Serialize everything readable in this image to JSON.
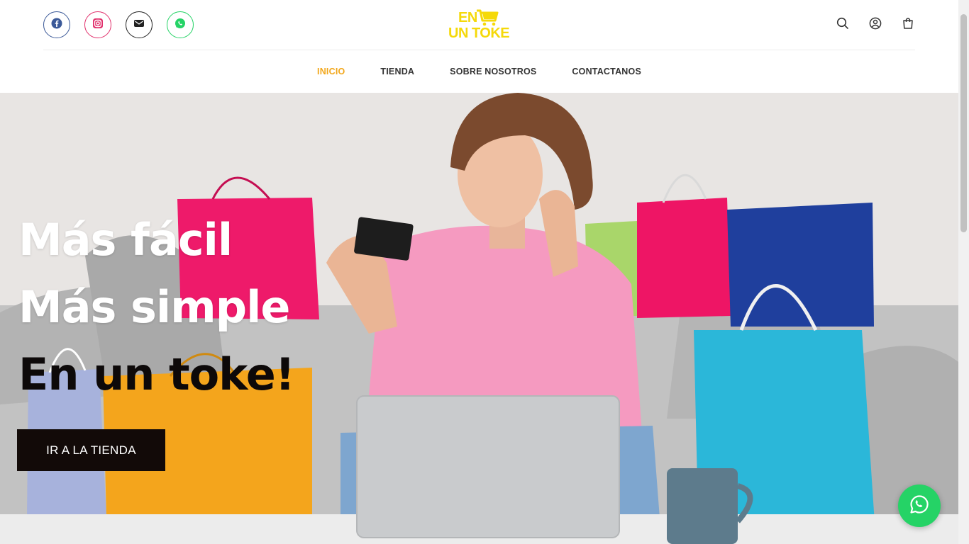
{
  "header": {
    "social": [
      {
        "name": "facebook",
        "icon": "facebook-icon",
        "color": "#3b5998"
      },
      {
        "name": "instagram",
        "icon": "instagram-icon",
        "color": "#e1306c"
      },
      {
        "name": "email",
        "icon": "envelope-icon",
        "color": "#222222"
      },
      {
        "name": "whatsapp",
        "icon": "whatsapp-icon",
        "color": "#25d366"
      }
    ],
    "logo": {
      "line1": "EN",
      "line2": "UN TOKE",
      "color": "#f5d90a",
      "icon": "shopping-cart-icon"
    },
    "icons": [
      "search-icon",
      "user-icon",
      "shopping-bag-icon"
    ]
  },
  "nav": {
    "items": [
      {
        "label": "INICIO",
        "active": true
      },
      {
        "label": "TIENDA",
        "active": false
      },
      {
        "label": "SOBRE NOSOTROS",
        "active": false
      },
      {
        "label": "CONTACTANOS",
        "active": false
      }
    ],
    "active_color": "#f2a71b"
  },
  "hero": {
    "line1": "Más fácil",
    "line2": "Más simple",
    "line3": "En un toke!",
    "cta_label": "IR A LA TIENDA"
  },
  "floating": {
    "icon": "whatsapp-icon",
    "color": "#25d366"
  }
}
